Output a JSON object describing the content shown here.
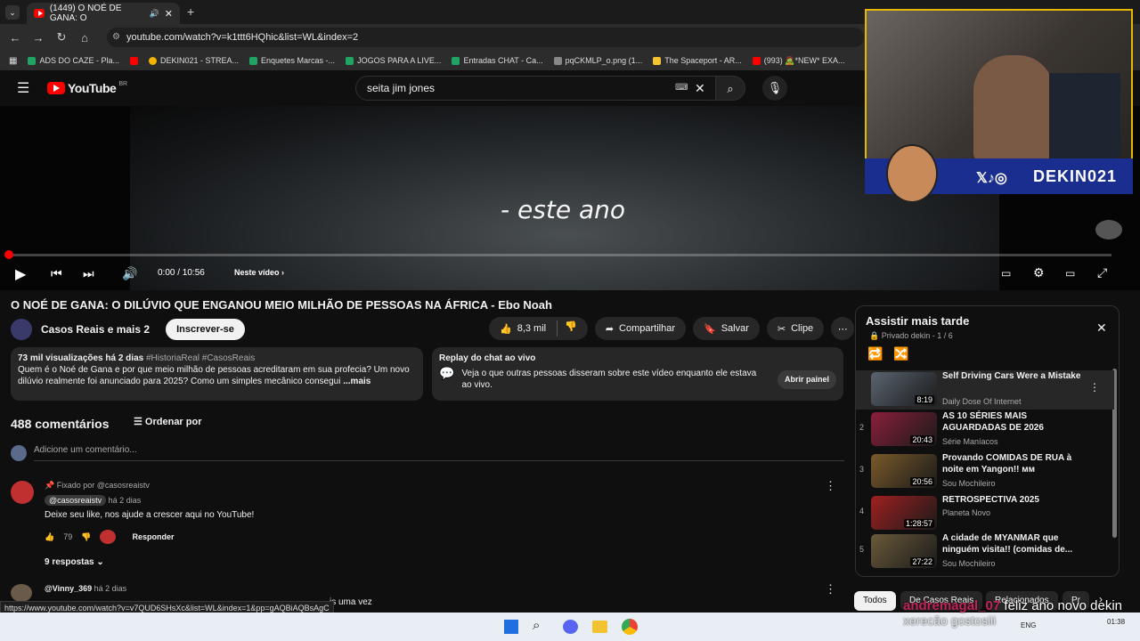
{
  "browser": {
    "tab_title": "(1449) O NOÉ DE GANA: O",
    "url": "youtube.com/watch?v=k1ttt6HQhic&list=WL&index=2",
    "bookmarks": [
      "ADS DO CAZE - Pla...",
      "DEKIN021 - STREA...",
      "Enquetes Marcas -...",
      "JOGOS PARA A LIVE...",
      "Entradas CHAT - Ca...",
      "pqCKMLP_o.png (1...",
      "The Spaceport - AR...",
      "(993) 🧟*NEW* EXA..."
    ]
  },
  "youtube": {
    "logo": "YouTube",
    "region": "BR",
    "search_value": "seita jim jones"
  },
  "player": {
    "caption": "- este ano",
    "time": "0:00 / 10:56",
    "chapter": "Neste vídeo",
    "progress_fraction": 0.003
  },
  "overlay": {
    "handle": "DEKIN021"
  },
  "video": {
    "title": "O NOÉ DE GANA: O DILÚVIO QUE ENGANOU MEIO MILHÃO DE PESSOAS NA ÁFRICA - Ebo Noah",
    "channel": "Casos Reais e mais 2",
    "subscribe": "Inscrever-se",
    "likes": "8,3 mil",
    "share": "Compartilhar",
    "save": "Salvar",
    "clip": "Clipe",
    "desc_meta": "73 mil visualizações  há 2 dias",
    "desc_tags": "#HistoriaReal #CasosReais",
    "desc_text": "Quem é o Noé de Gana e por que meio milhão de pessoas acreditaram em sua profecia? Um novo dilúvio realmente foi anunciado para 2025? Como um simples mecânico consegui",
    "desc_more": "...mais",
    "replay_title": "Replay do chat ao vivo",
    "replay_text": "Veja o que outras pessoas disseram sobre este vídeo enquanto ele estava ao vivo.",
    "replay_btn": "Abrir painel"
  },
  "comments": {
    "count": "488 comentários",
    "sort": "Ordenar por",
    "placeholder": "Adicione um comentário...",
    "pinned": "Fixado por @casosreaistv",
    "author": "@casosreaistv",
    "time": "há 2 dias",
    "text": "Deixe seu like, nos ajude a crescer aqui no YouTube!",
    "likes": "79",
    "reply": "Responder",
    "replies": "9 respostas",
    "author2": "@Vinny_369",
    "time2": "há 2 dias",
    "text2": "is uma vez"
  },
  "playlist": {
    "title": "Assistir mais tarde",
    "meta": "Privado dekin - 1 / 6",
    "items": [
      {
        "num": "",
        "title": "Self Driving Cars Were a Mistake",
        "channel": "Daily Dose Of Internet",
        "duration": "8:19",
        "color": "#5a6470"
      },
      {
        "num": "2",
        "title": "AS 10 SÉRIES MAIS AGUARDADAS DE 2026",
        "channel": "Série Maníacos",
        "duration": "20:43",
        "color": "#8a1f3a"
      },
      {
        "num": "3",
        "title": "Provando COMIDAS DE RUA à noite em Yangon!! ᴍᴍ",
        "channel": "Sou Mochileiro",
        "duration": "20:56",
        "color": "#7a5a2a"
      },
      {
        "num": "4",
        "title": "RETROSPECTIVA 2025",
        "channel": "Planeta Novo",
        "duration": "1:28:57",
        "color": "#a02020"
      },
      {
        "num": "5",
        "title": "A cidade de MYANMAR que ninguém visita!! (comidas de...",
        "channel": "Sou Mochileiro",
        "duration": "27:22",
        "color": "#6a5a3a"
      }
    ]
  },
  "chips": [
    "Todos",
    "De Casos Reais",
    "Relacionados",
    "Pr"
  ],
  "status_url": "https://www.youtube.com/watch?v=v7QUD6SHsXc&list=WL&index=1&pp=gAQBiAQBsAgC",
  "chat": {
    "line1_user": "andremagal_07",
    "line1_text": "feliz ano novo dekin",
    "line2": "xerecão gostosiii"
  },
  "taskbar": {
    "lang": "ENG",
    "time": "01:38"
  }
}
